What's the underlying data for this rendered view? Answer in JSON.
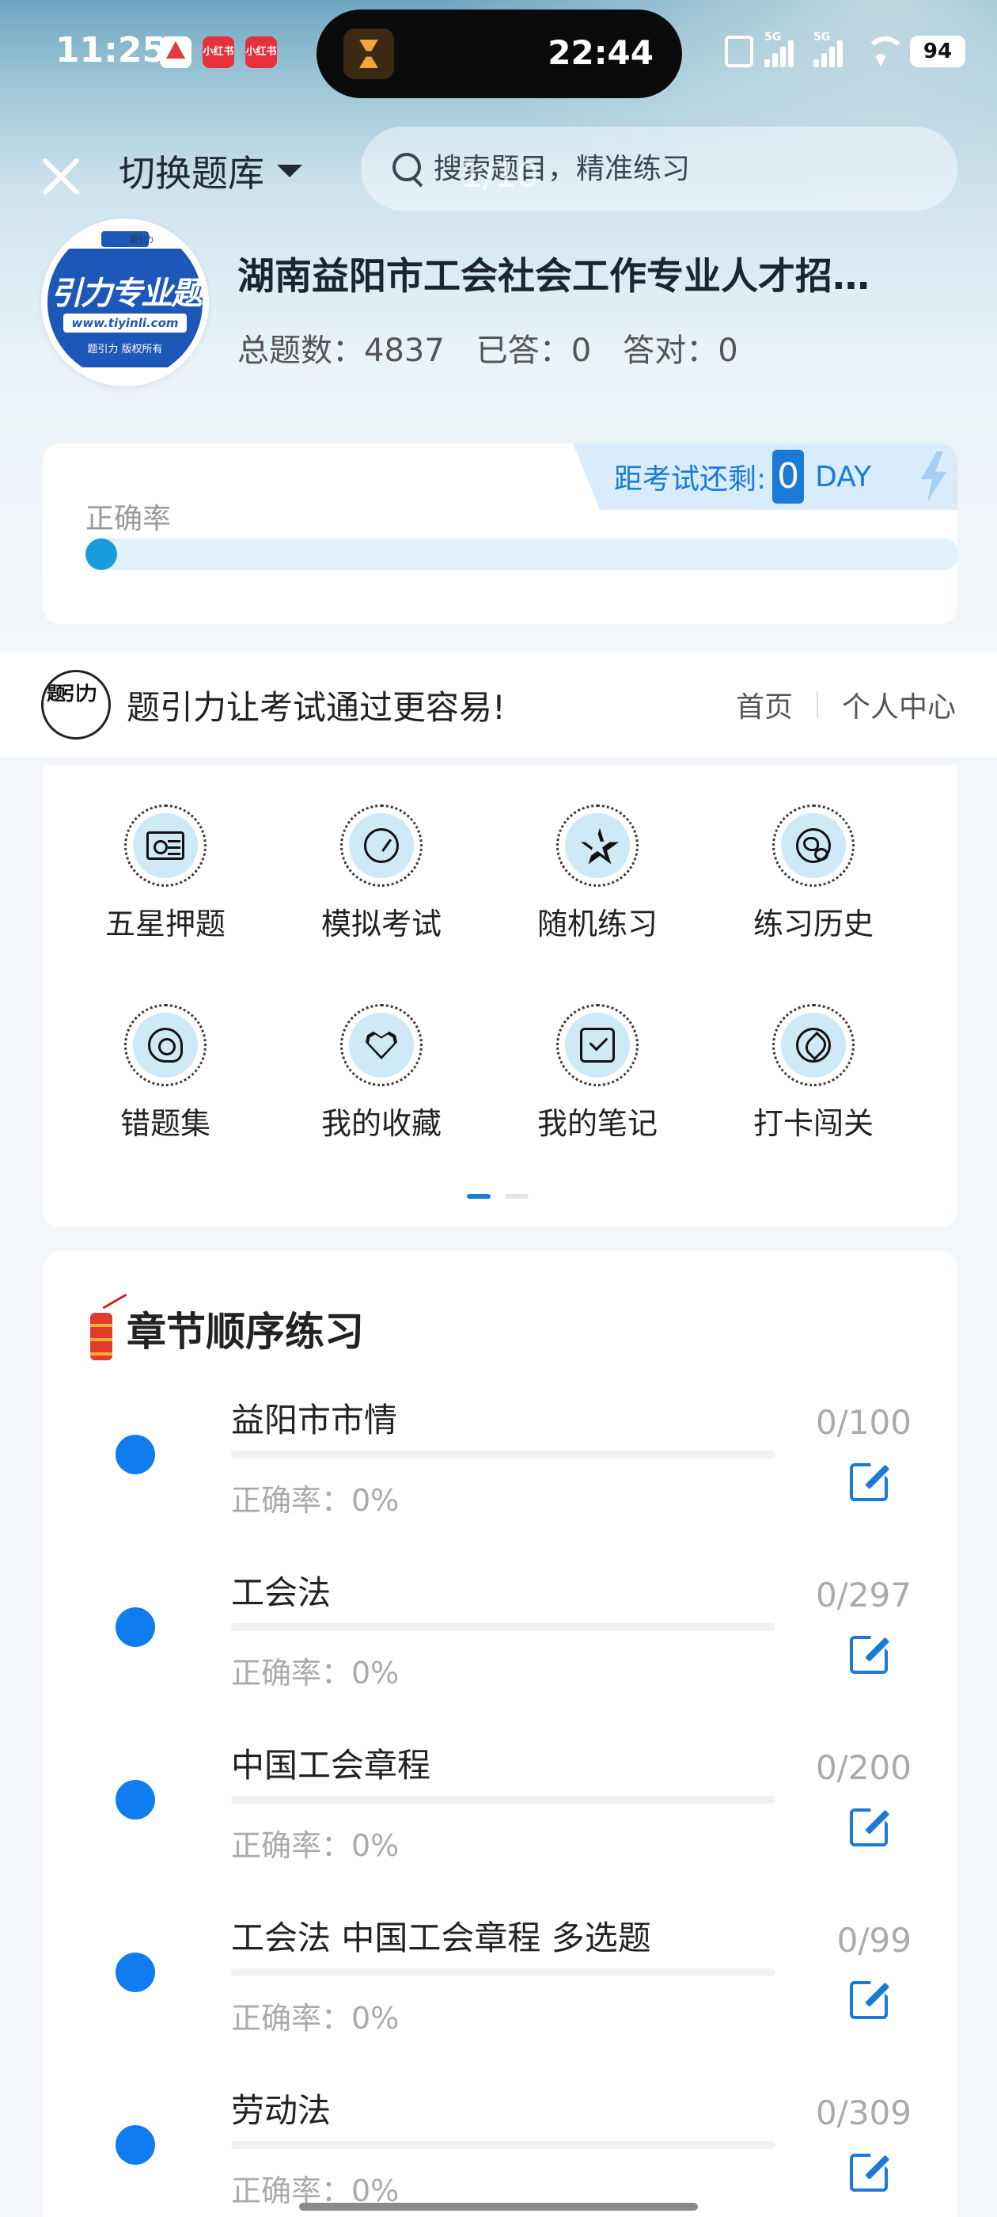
{
  "status_bar": {
    "time": "11:25",
    "apps": [
      "",
      "小红书",
      "小红书"
    ],
    "island_time": "22:44",
    "battery": "94",
    "signal_labels": [
      "5G",
      "5G"
    ]
  },
  "header": {
    "switch_bank_label": "切换题库",
    "search_placeholder": "搜索题目，精准练习",
    "page_indicator": "1/10"
  },
  "bank": {
    "logo": {
      "top_text": "题引力",
      "title": "引力专业题",
      "url": "www.tiyinli.com",
      "copyright": "题引力 版权所有"
    },
    "title": "湖南益阳市工会社会工作专业人才招…",
    "stats": {
      "total_label": "总题数：4837",
      "answered_label": "已答：0",
      "correct_label": "答对：0"
    }
  },
  "accuracy_card": {
    "countdown_label": "距考试还剩:",
    "countdown_value": "0",
    "countdown_unit": "DAY",
    "accuracy_label": "正确率",
    "accuracy_fraction": 0
  },
  "brand": {
    "slogan": "题引力让考试通过更容易!",
    "links": [
      "首页",
      "个人中心"
    ]
  },
  "menu": {
    "items": [
      {
        "label": "五星押题",
        "icon": "id-card-icon"
      },
      {
        "label": "模拟考试",
        "icon": "gauge-icon"
      },
      {
        "label": "随机练习",
        "icon": "star-icon"
      },
      {
        "label": "练习历史",
        "icon": "globe-icon"
      },
      {
        "label": "错题集",
        "icon": "head-icon"
      },
      {
        "label": "我的收藏",
        "icon": "heart-icon"
      },
      {
        "label": "我的笔记",
        "icon": "checkbox-icon"
      },
      {
        "label": "打卡闯关",
        "icon": "leaf-icon"
      }
    ],
    "page_dots": {
      "total": 2,
      "active": 0
    }
  },
  "chapters": {
    "title": "章节顺序练习",
    "accuracy_text": "正确率：0%",
    "items": [
      {
        "name": "益阳市市情",
        "count": "0/100",
        "progress": 0
      },
      {
        "name": "工会法",
        "count": "0/297",
        "progress": 0
      },
      {
        "name": "中国工会章程",
        "count": "0/200",
        "progress": 0
      },
      {
        "name": "工会法 中国工会章程 多选题",
        "count": "0/99",
        "progress": 0
      },
      {
        "name": "劳动法",
        "count": "0/309",
        "progress": 0
      }
    ]
  },
  "colors": {
    "accent": "#1a7ad6",
    "bullet": "#0f7df0",
    "accuracy_track": "#e3f1fb",
    "icon_bg": "#cfeaf7"
  }
}
